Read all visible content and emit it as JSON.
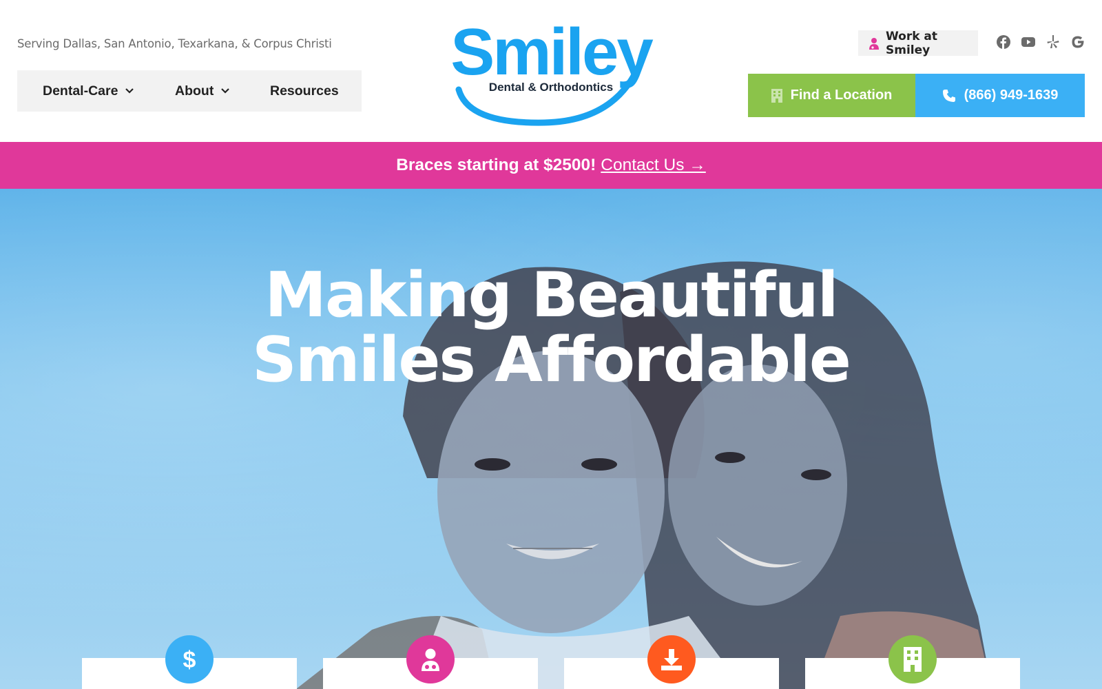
{
  "header": {
    "service_area": "Serving Dallas, San Antonio, Texarkana, & Corpus Christi",
    "nav": [
      {
        "label": "Dental-Care",
        "has_dropdown": true
      },
      {
        "label": "About",
        "has_dropdown": true
      },
      {
        "label": "Resources",
        "has_dropdown": false
      }
    ],
    "logo": {
      "word": "Smiley",
      "tagline": "Dental & Orthodontics"
    },
    "work_button": "Work at Smiley",
    "socials": [
      "facebook-icon",
      "youtube-icon",
      "yelp-icon",
      "google-icon"
    ],
    "find_location": "Find a Location",
    "phone": "(866) 949-1639"
  },
  "promo": {
    "lead": "Braces starting at $2500!",
    "cta": "Contact Us →"
  },
  "hero": {
    "headline_line1": "Making Beautiful",
    "headline_line2": "Smiles Affordable"
  },
  "cards": [
    {
      "icon": "dollar-icon",
      "color": "#3bb0f5"
    },
    {
      "icon": "doctor-icon",
      "color": "#e0389a"
    },
    {
      "icon": "download-icon",
      "color": "#ff5a1f"
    },
    {
      "icon": "building-icon",
      "color": "#8bc34a"
    }
  ],
  "colors": {
    "brand_blue": "#1aa3f0",
    "accent_green": "#8bc34a",
    "accent_pink": "#e0389a",
    "accent_orange": "#ff5a1f"
  }
}
